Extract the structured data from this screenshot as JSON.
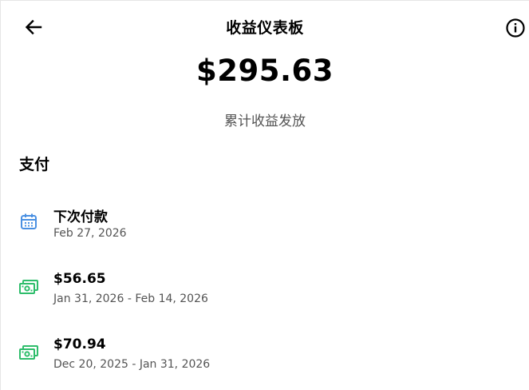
{
  "header": {
    "title": "收益仪表板",
    "back_icon": "arrow-left-icon",
    "info_icon": "info-circle-icon"
  },
  "summary": {
    "amount": "$295.63",
    "caption": "累计收益发放"
  },
  "payments": {
    "section_title": "支付",
    "items": [
      {
        "icon": "calendar-icon",
        "title": "下次付款",
        "subtitle": "Feb 27, 2026"
      },
      {
        "icon": "cash-icon",
        "title": "$56.65",
        "subtitle": "Jan 31, 2026 - Feb 14, 2026"
      },
      {
        "icon": "cash-icon",
        "title": "$70.94",
        "subtitle": "Dec 20, 2025 - Jan 31, 2026"
      }
    ]
  },
  "colors": {
    "calendar_icon": "#4A90E2",
    "cash_icon": "#2EBD6B",
    "secondary_text": "#545454"
  }
}
